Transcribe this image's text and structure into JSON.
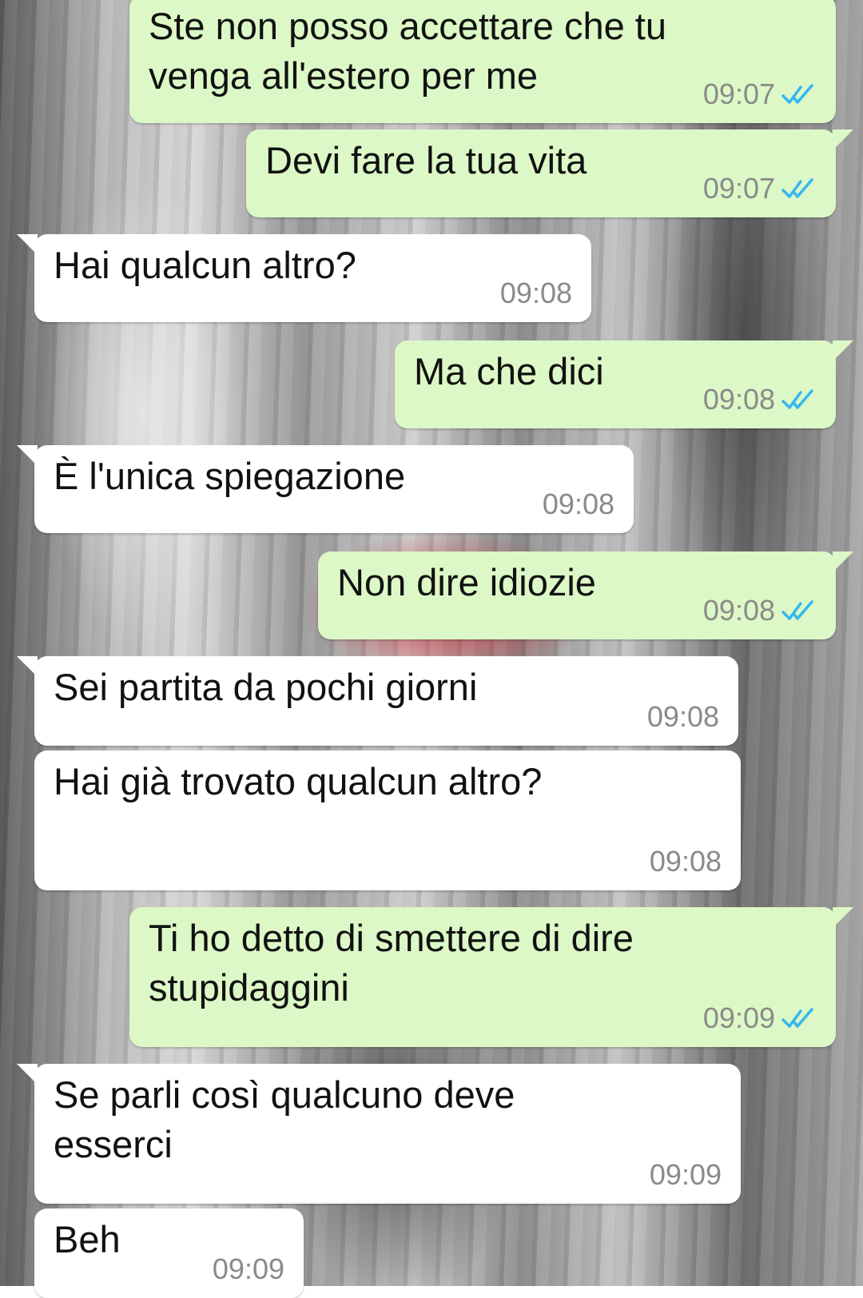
{
  "messages": [
    {
      "id": "m1",
      "direction": "outgoing",
      "text": "Ste non posso accettare che tu\nvenga all'estero per me",
      "time": "09:07",
      "read": true
    },
    {
      "id": "m2",
      "direction": "outgoing",
      "text": "Devi fare la tua vita",
      "time": "09:07",
      "read": true
    },
    {
      "id": "m3",
      "direction": "incoming",
      "text": "Hai qualcun altro?",
      "time": "09:08"
    },
    {
      "id": "m4",
      "direction": "outgoing",
      "text": "Ma che dici",
      "time": "09:08",
      "read": true
    },
    {
      "id": "m5",
      "direction": "incoming",
      "text": "È l'unica spiegazione",
      "time": "09:08"
    },
    {
      "id": "m6",
      "direction": "outgoing",
      "text": "Non dire idiozie",
      "time": "09:08",
      "read": true
    },
    {
      "id": "m7",
      "direction": "incoming",
      "text": "Sei partita da pochi giorni",
      "time": "09:08"
    },
    {
      "id": "m8",
      "direction": "incoming",
      "text": "Hai già trovato qualcun altro?",
      "time": "09:08"
    },
    {
      "id": "m9",
      "direction": "outgoing",
      "text": "Ti ho detto di smettere di dire\nstupidaggini",
      "time": "09:09",
      "read": true
    },
    {
      "id": "m10",
      "direction": "incoming",
      "text": "Se parli così qualcuno deve\nesserci",
      "time": "09:09"
    },
    {
      "id": "m11",
      "direction": "incoming",
      "text": "Beh",
      "time": "09:09"
    }
  ],
  "colors": {
    "outgoing_bubble": "#dcf8c6",
    "incoming_bubble": "#ffffff",
    "read_ticks": "#34b7f1",
    "timestamp": "#8a8a8a"
  },
  "icons": {
    "read_receipt": "double-check-icon"
  }
}
